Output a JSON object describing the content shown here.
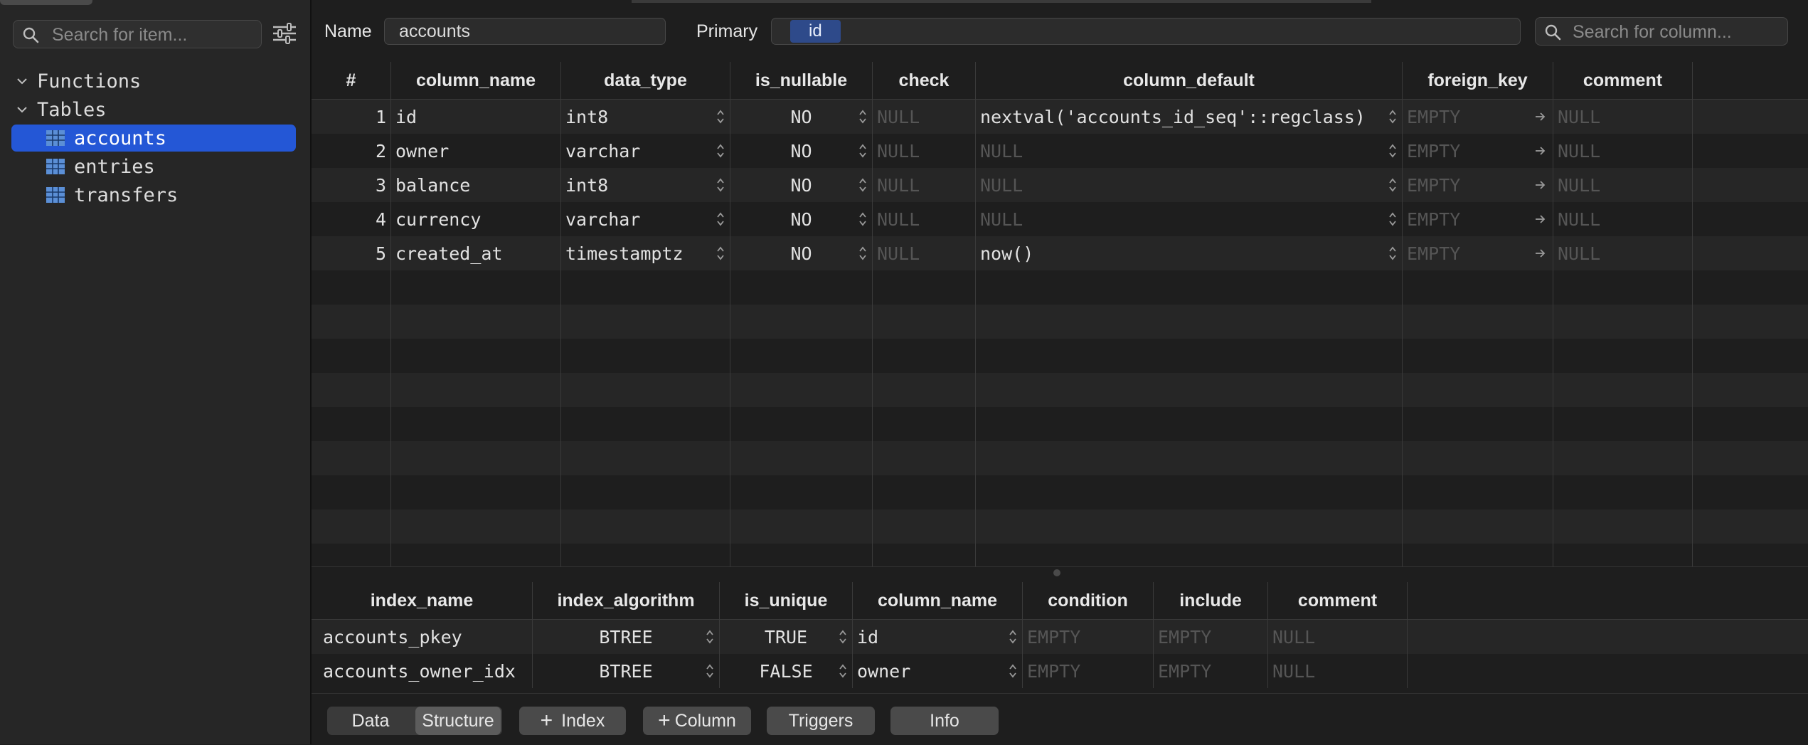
{
  "sidebar": {
    "search_placeholder": "Search for item...",
    "sections": [
      {
        "label": "Functions"
      },
      {
        "label": "Tables"
      }
    ],
    "tables": [
      {
        "label": "accounts",
        "selected": true
      },
      {
        "label": "entries",
        "selected": false
      },
      {
        "label": "transfers",
        "selected": false
      }
    ]
  },
  "header": {
    "name_label": "Name",
    "name_value": "accounts",
    "primary_label": "Primary",
    "primary_value": "id",
    "column_search_placeholder": "Search for column..."
  },
  "columns_table": {
    "headers": [
      "#",
      "column_name",
      "data_type",
      "is_nullable",
      "check",
      "column_default",
      "foreign_key",
      "comment"
    ],
    "rows": [
      {
        "num": "1",
        "column_name": "id",
        "data_type": "int8",
        "is_nullable": "NO",
        "check": "NULL",
        "column_default": "nextval('accounts_id_seq'::regclass)",
        "default_dim": false,
        "foreign_key": "EMPTY",
        "comment": "NULL"
      },
      {
        "num": "2",
        "column_name": "owner",
        "data_type": "varchar",
        "is_nullable": "NO",
        "check": "NULL",
        "column_default": "NULL",
        "default_dim": true,
        "foreign_key": "EMPTY",
        "comment": "NULL"
      },
      {
        "num": "3",
        "column_name": "balance",
        "data_type": "int8",
        "is_nullable": "NO",
        "check": "NULL",
        "column_default": "NULL",
        "default_dim": true,
        "foreign_key": "EMPTY",
        "comment": "NULL"
      },
      {
        "num": "4",
        "column_name": "currency",
        "data_type": "varchar",
        "is_nullable": "NO",
        "check": "NULL",
        "column_default": "NULL",
        "default_dim": true,
        "foreign_key": "EMPTY",
        "comment": "NULL"
      },
      {
        "num": "5",
        "column_name": "created_at",
        "data_type": "timestamptz",
        "is_nullable": "NO",
        "check": "NULL",
        "column_default": "now()",
        "default_dim": false,
        "foreign_key": "EMPTY",
        "comment": "NULL"
      }
    ]
  },
  "index_table": {
    "headers": [
      "index_name",
      "index_algorithm",
      "is_unique",
      "column_name",
      "condition",
      "include",
      "comment"
    ],
    "rows": [
      {
        "index_name": "accounts_pkey",
        "index_algorithm": "BTREE",
        "is_unique": "TRUE",
        "column_name": "id",
        "condition": "EMPTY",
        "include": "EMPTY",
        "comment": "NULL"
      },
      {
        "index_name": "accounts_owner_idx",
        "index_algorithm": "BTREE",
        "is_unique": "FALSE",
        "column_name": "owner",
        "condition": "EMPTY",
        "include": "EMPTY",
        "comment": "NULL"
      }
    ]
  },
  "bottom_bar": {
    "tabs": [
      {
        "label": "Data",
        "active": false
      },
      {
        "label": "Structure",
        "active": true
      }
    ],
    "buttons": [
      {
        "label": "Index",
        "plus": true
      },
      {
        "label": "Column",
        "plus": true
      },
      {
        "label": "Triggers",
        "plus": false
      },
      {
        "label": "Info",
        "plus": false
      }
    ]
  },
  "colors": {
    "selection": "#2457d6",
    "primary_chip": "#2e4a8a",
    "background": "#1e1e1e",
    "sidebar": "#262626"
  }
}
